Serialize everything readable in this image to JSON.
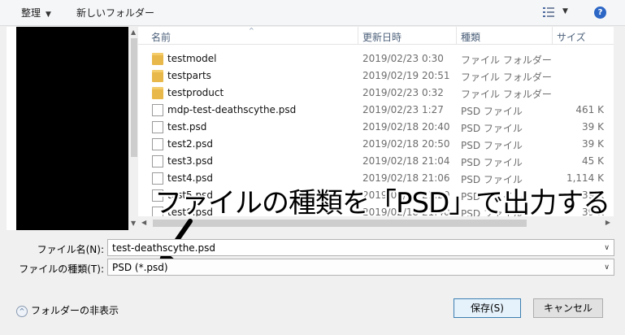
{
  "toolbar": {
    "organize_label": "整理",
    "organize_caret": "▼",
    "new_folder_label": "新しいフォルダー",
    "view_caret": "▼",
    "help_label": "?"
  },
  "columns": {
    "name": "名前",
    "date": "更新日時",
    "type": "種類",
    "size": "サイズ"
  },
  "files": [
    {
      "name": "testmodel",
      "date": "2019/02/23 0:30",
      "type": "ファイル フォルダー",
      "size": "",
      "kind": "folder"
    },
    {
      "name": "testparts",
      "date": "2019/02/19 20:51",
      "type": "ファイル フォルダー",
      "size": "",
      "kind": "folder"
    },
    {
      "name": "testproduct",
      "date": "2019/02/23 0:32",
      "type": "ファイル フォルダー",
      "size": "",
      "kind": "folder"
    },
    {
      "name": "mdp-test-deathscythe.psd",
      "date": "2019/02/23 1:27",
      "type": "PSD ファイル",
      "size": "461 K",
      "kind": "file"
    },
    {
      "name": "test.psd",
      "date": "2019/02/18 20:40",
      "type": "PSD ファイル",
      "size": "39 K",
      "kind": "file"
    },
    {
      "name": "test2.psd",
      "date": "2019/02/18 20:50",
      "type": "PSD ファイル",
      "size": "39 K",
      "kind": "file"
    },
    {
      "name": "test3.psd",
      "date": "2019/02/18 21:04",
      "type": "PSD ファイル",
      "size": "45 K",
      "kind": "file"
    },
    {
      "name": "test4.psd",
      "date": "2019/02/18 21:06",
      "type": "PSD ファイル",
      "size": "1,114 K",
      "kind": "file"
    },
    {
      "name": "test5.psd",
      "date": "2019/02/18 21:20",
      "type": "PSD ファイル",
      "size": "39 K",
      "kind": "file"
    },
    {
      "name": "test6.psd",
      "date": "2019/02/18 21:40",
      "type": "PSD ファイル",
      "size": "39 K",
      "kind": "file"
    }
  ],
  "annotation": "ファイルの種類を「PSD」で出力する",
  "form": {
    "file_name_label": "ファイル名(N):",
    "file_name_value": "test-deathscythe.psd",
    "file_type_label": "ファイルの種類(T):",
    "file_type_value": "PSD (*.psd)",
    "dropdown_caret": "∨"
  },
  "footer": {
    "hide_folders_label": "フォルダーの非表示",
    "save_label": "保存(S)",
    "cancel_label": "キャンセル"
  }
}
